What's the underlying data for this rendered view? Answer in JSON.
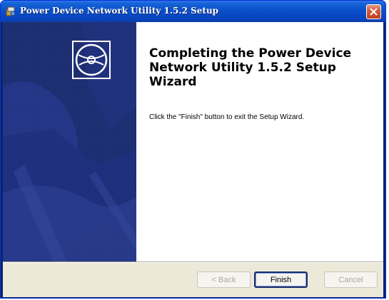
{
  "window": {
    "title": "Power Device Network Utility 1.5.2 Setup"
  },
  "wizard": {
    "heading": "Completing the Power Device Network Utility 1.5.2 Setup Wizard",
    "description": "Click the \"Finish\" button to exit the Setup Wizard."
  },
  "buttons": {
    "back_label": "< Back",
    "finish_label": "Finish",
    "cancel_label": "Cancel"
  },
  "colors": {
    "banner_navy": "#1a2a6c",
    "banner_light": "#2b3d8f",
    "titlebar_blue": "#0a50c9",
    "close_red": "#d15a3d",
    "dialog_bg": "#ece9d8"
  },
  "icons": {
    "title_icon": "installer-icon",
    "banner_icon": "cd-disc-icon",
    "close_icon": "close-x-icon"
  }
}
